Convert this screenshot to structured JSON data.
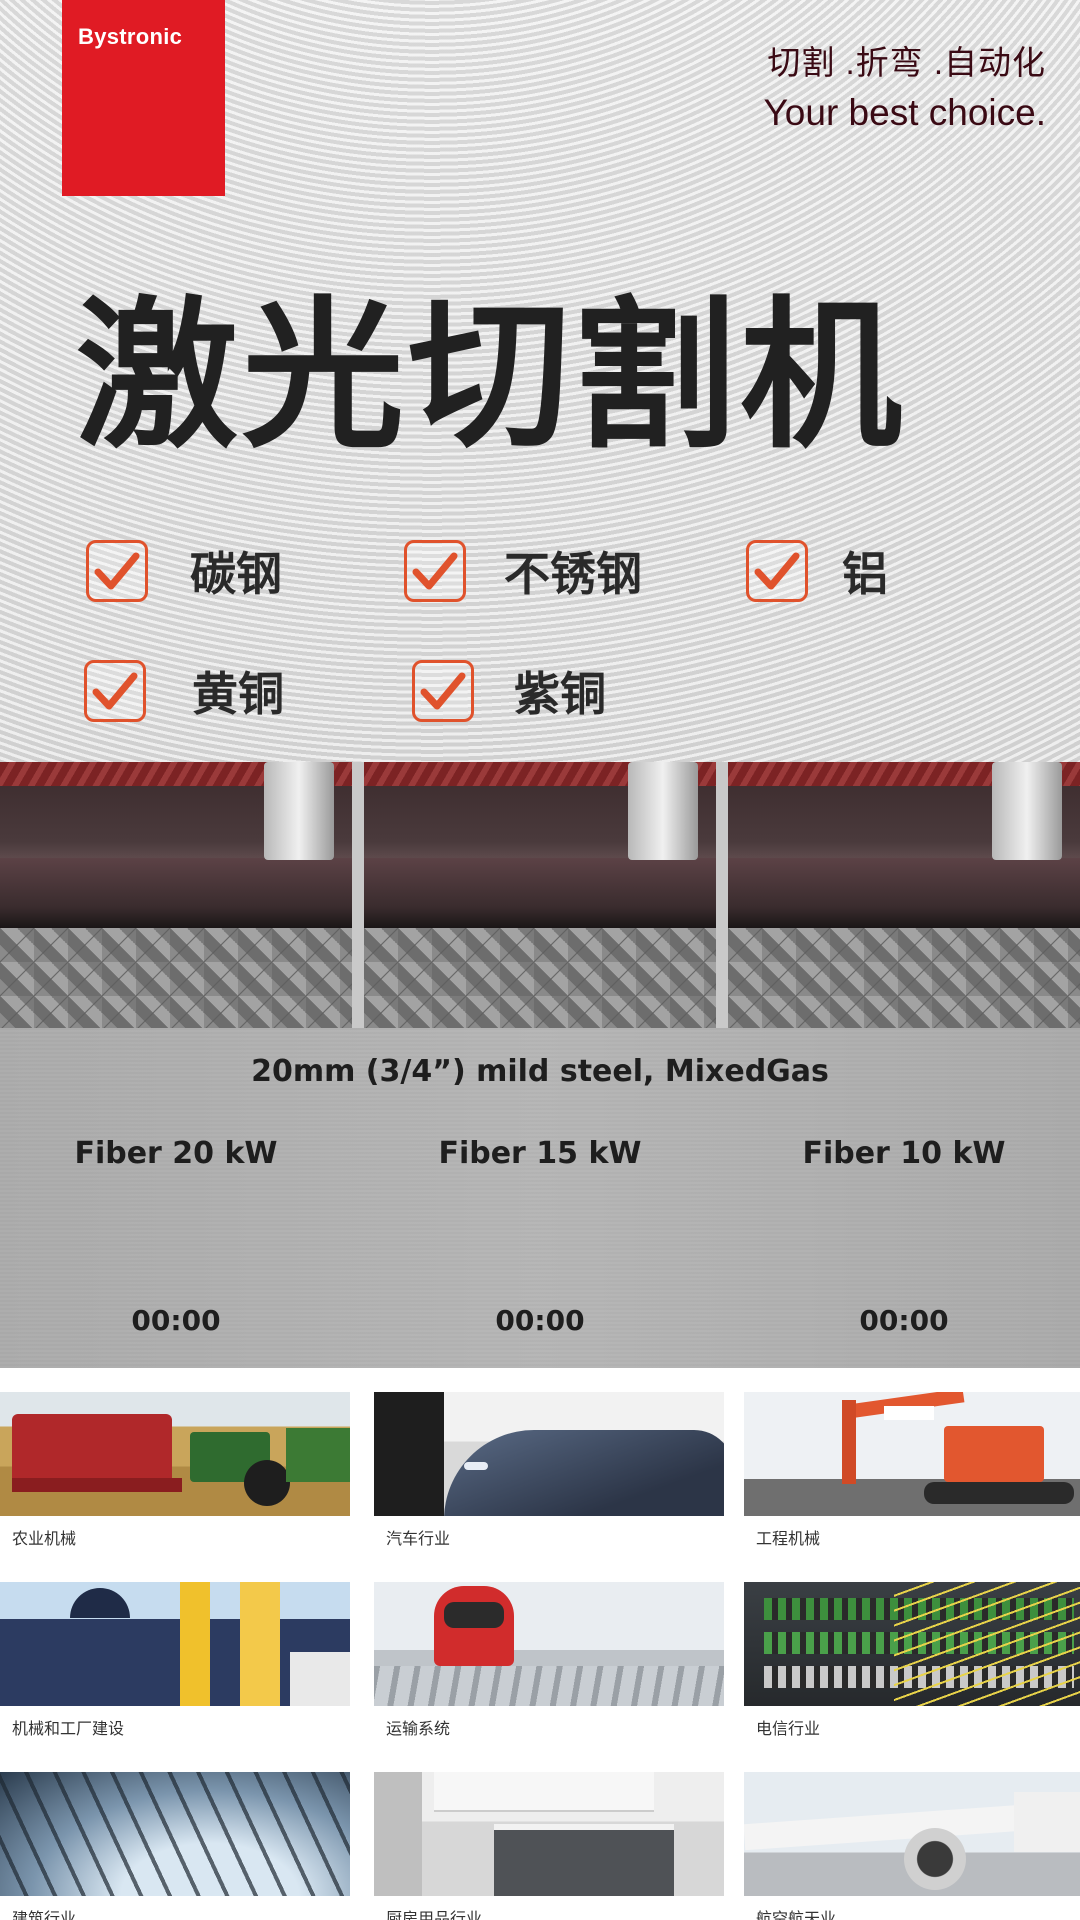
{
  "brand": {
    "logo_text": "Bystronic",
    "accent_color": "#e01b24"
  },
  "tagline": {
    "line1": "切割 .折弯 .自动化",
    "line2": "Your best choice."
  },
  "headline": "激光切割机",
  "materials": [
    {
      "label": "碳钢",
      "checked": true
    },
    {
      "label": "不锈钢",
      "checked": true
    },
    {
      "label": "铝",
      "checked": true
    },
    {
      "label": "黄铜",
      "checked": true
    },
    {
      "label": "紫铜",
      "checked": true
    }
  ],
  "comparison": {
    "title": "20mm (3/4”) mild steel, MixedGas",
    "machines": [
      {
        "label": "Fiber 20 kW",
        "timer": "00:00"
      },
      {
        "label": "Fiber 15 kW",
        "timer": "00:00"
      },
      {
        "label": "Fiber 10 kW",
        "timer": "00:00"
      }
    ]
  },
  "industries": [
    {
      "label": "农业机械",
      "icon": "harvester-photo"
    },
    {
      "label": "汽车行业",
      "icon": "car-photo"
    },
    {
      "label": "工程机械",
      "icon": "excavator-photo"
    },
    {
      "label": "机械和工厂建设",
      "icon": "factory-photo"
    },
    {
      "label": "运输系统",
      "icon": "train-photo"
    },
    {
      "label": "电信行业",
      "icon": "network-photo"
    },
    {
      "label": "建筑行业",
      "icon": "building-photo"
    },
    {
      "label": "厨房用品行业",
      "icon": "kitchen-photo"
    },
    {
      "label": "航空航天业",
      "icon": "airplane-photo"
    }
  ]
}
